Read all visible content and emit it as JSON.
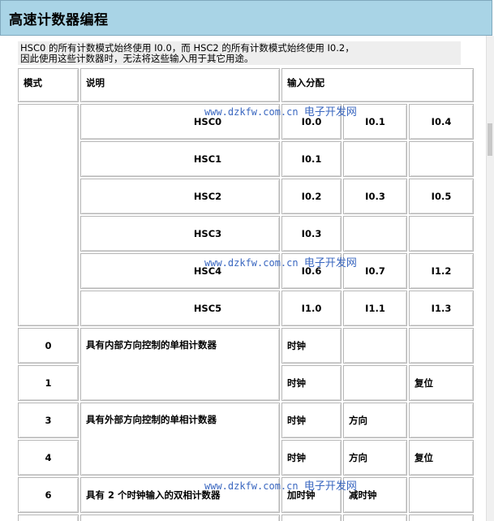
{
  "header": {
    "title": "高速计数器编程"
  },
  "note": {
    "line1": "HSC0 的所有计数模式始终使用 I0.0，而 HSC2 的所有计数模式始终使用 I0.2，",
    "line2": "因此使用这些计数器时，无法将这些输入用于其它用途。"
  },
  "table": {
    "headers": {
      "mode": "模式",
      "description": "说明",
      "inputs": "输入分配"
    },
    "counter_rows": [
      {
        "name": "HSC0",
        "inputs": [
          "I0.0",
          "I0.1",
          "I0.4"
        ]
      },
      {
        "name": "HSC1",
        "inputs": [
          "I0.1",
          "",
          ""
        ]
      },
      {
        "name": "HSC2",
        "inputs": [
          "I0.2",
          "I0.3",
          "I0.5"
        ]
      },
      {
        "name": "HSC3",
        "inputs": [
          "I0.3",
          "",
          ""
        ]
      },
      {
        "name": "HSC4",
        "inputs": [
          "I0.6",
          "I0.7",
          "I1.2"
        ]
      },
      {
        "name": "HSC5",
        "inputs": [
          "I1.0",
          "I1.1",
          "I1.3"
        ]
      }
    ],
    "mode_rows": [
      {
        "mode": "0",
        "description": "具有内部方向控制的单相计数器",
        "inputs": [
          "时钟",
          "",
          ""
        ]
      },
      {
        "mode": "1",
        "description": "",
        "inputs": [
          "时钟",
          "",
          "复位"
        ]
      },
      {
        "mode": "3",
        "description": "具有外部方向控制的单相计数器",
        "inputs": [
          "时钟",
          "方向",
          ""
        ]
      },
      {
        "mode": "4",
        "description": "",
        "inputs": [
          "时钟",
          "方向",
          "复位"
        ]
      },
      {
        "mode": "6",
        "description": "具有 2 个时钟输入的双相计数器",
        "inputs": [
          "加时钟",
          "减时钟",
          ""
        ]
      }
    ]
  },
  "watermark": {
    "url": "www.dzkfw.com.cn",
    "site": "电子开发网"
  }
}
